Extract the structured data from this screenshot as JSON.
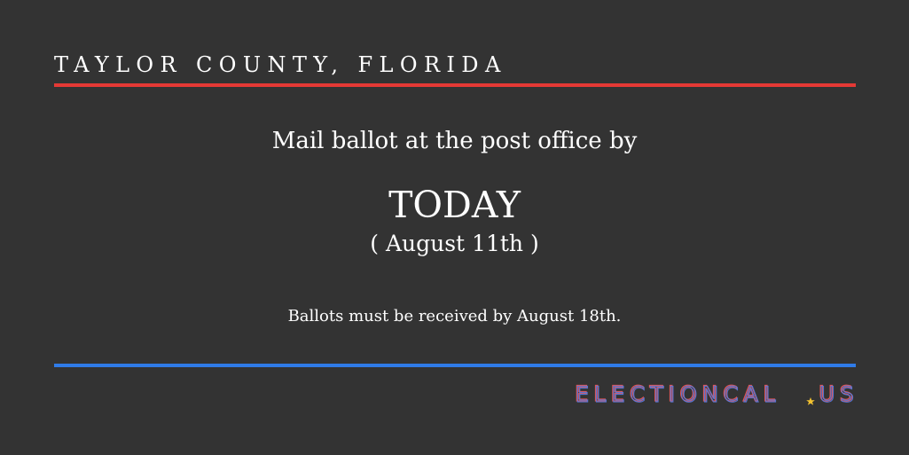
{
  "header": {
    "county": "TAYLOR COUNTY, FLORIDA"
  },
  "main": {
    "mail_line": "Mail ballot at the post office by",
    "deadline": "TODAY",
    "deadline_date": "( August 11th )",
    "received_note": "Ballots must be received by August 18th."
  },
  "footer": {
    "logo_text": "ELECTIONCAL.US"
  },
  "colors": {
    "background": "#333333",
    "top_rule": "#e53935",
    "bottom_rule": "#2f7be8",
    "logo_red": "#e25555",
    "logo_blue": "#5a7be0",
    "logo_star": "#f2c230"
  }
}
